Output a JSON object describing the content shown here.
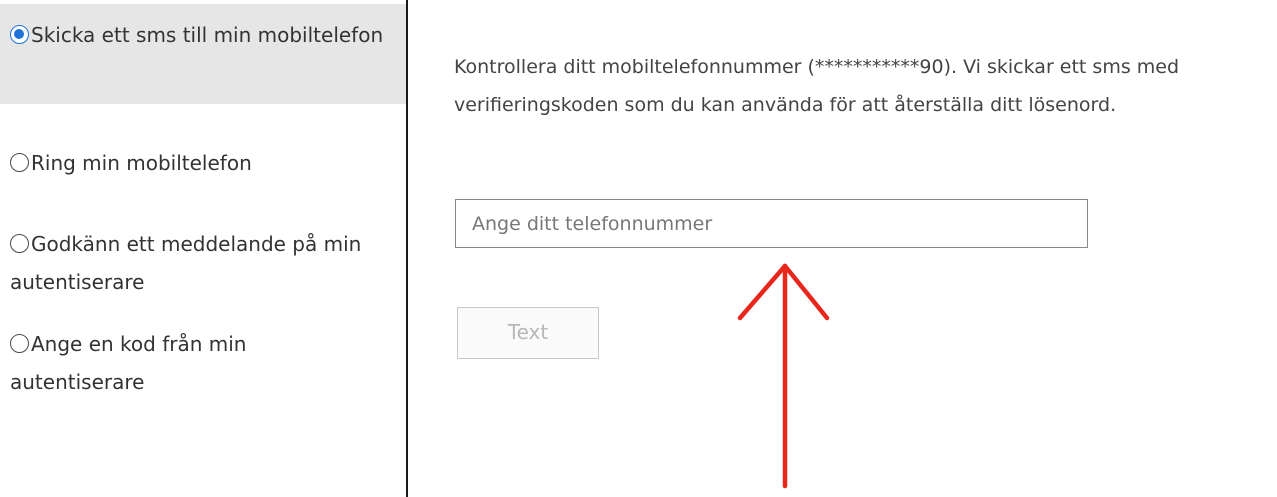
{
  "options": [
    {
      "label": "Skicka ett sms till min mobiltelefon",
      "selected": true
    },
    {
      "label": "Ring min mobiltelefon",
      "selected": false
    },
    {
      "label": "Godkänn ett meddelande på min autentiserare",
      "selected": false
    },
    {
      "label": "Ange en kod från min autentiserare",
      "selected": false
    }
  ],
  "main": {
    "description": "Kontrollera ditt mobiltelefonnummer (***********90). Vi skickar ett sms med verifieringskoden som du kan använda för att återställa ditt lösenord.",
    "phone_placeholder": "Ange ditt telefonnummer",
    "phone_value": "",
    "text_button_label": "Text"
  },
  "colors": {
    "accent": "#1e73d8",
    "selected_bg": "#e6e6e6",
    "annotation_arrow": "#e8261c"
  },
  "icons": {
    "radio_checked": "radio-checked-icon",
    "radio_unchecked": "radio-unchecked-icon",
    "annotation": "red-arrow-up-icon"
  }
}
